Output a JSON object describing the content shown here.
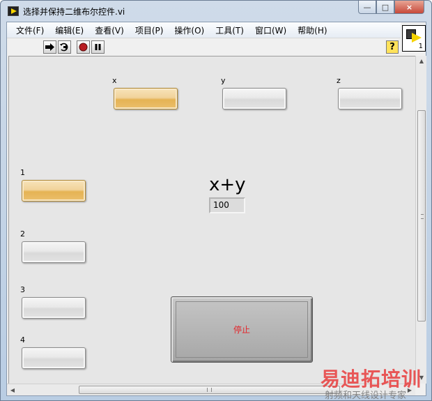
{
  "window": {
    "title": "选择并保持二维布尔控件.vi",
    "min_label": "—",
    "max_label": "□",
    "close_label": "×"
  },
  "menu": [
    "文件(F)",
    "编辑(E)",
    "查看(V)",
    "项目(P)",
    "操作(O)",
    "工具(T)",
    "窗口(W)",
    "帮助(H)"
  ],
  "toolbar": {
    "run_icon": "run-arrow-icon",
    "run_continuous_icon": "run-continuously-icon",
    "abort_icon": "abort-execution-icon",
    "pause_icon": "pause-icon",
    "help_label": "?"
  },
  "vi_icon": {
    "number": "1"
  },
  "panel": {
    "top_buttons": [
      {
        "label": "x",
        "state": "on"
      },
      {
        "label": "y",
        "state": "off"
      },
      {
        "label": "z",
        "state": "off"
      }
    ],
    "left_buttons": [
      {
        "label": "1",
        "state": "on"
      },
      {
        "label": "2",
        "state": "off"
      },
      {
        "label": "3",
        "state": "off"
      },
      {
        "label": "4",
        "state": "off"
      }
    ],
    "indicator": {
      "label": "x+y",
      "value": "100"
    },
    "stop_button": {
      "label": "停止"
    }
  },
  "colors": {
    "bool_on": "#ebbf6c",
    "bool_off": "#e3e3e3",
    "stop_text": "#e3252b",
    "panel_bg": "#e6e6e6"
  },
  "watermark": {
    "big": "易迪拓培训",
    "small": "射频和天线设计专家"
  }
}
